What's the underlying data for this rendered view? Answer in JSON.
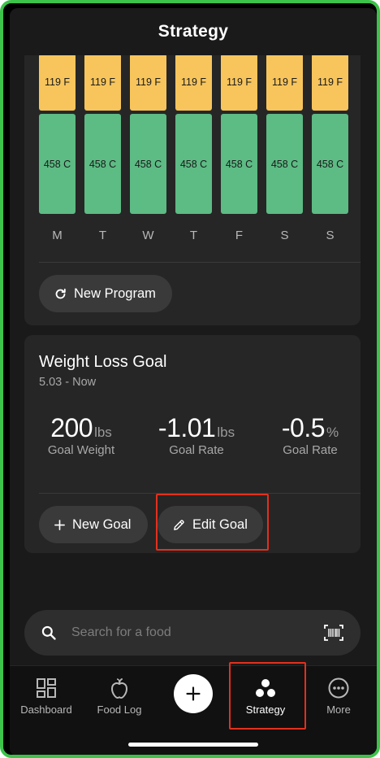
{
  "header": {
    "title": "Strategy"
  },
  "program": {
    "days": [
      {
        "day": "M",
        "fat": "119 F",
        "carb": "458 C"
      },
      {
        "day": "T",
        "fat": "119 F",
        "carb": "458 C"
      },
      {
        "day": "W",
        "fat": "119 F",
        "carb": "458 C"
      },
      {
        "day": "T",
        "fat": "119 F",
        "carb": "458 C"
      },
      {
        "day": "F",
        "fat": "119 F",
        "carb": "458 C"
      },
      {
        "day": "S",
        "fat": "119 F",
        "carb": "458 C"
      },
      {
        "day": "S",
        "fat": "119 F",
        "carb": "458 C"
      }
    ],
    "new_program_label": "New Program"
  },
  "goal": {
    "title": "Weight Loss Goal",
    "subtitle": "5.03 - Now",
    "stats": [
      {
        "value": "200",
        "unit": "lbs",
        "label": "Goal Weight"
      },
      {
        "value": "-1.01",
        "unit": "lbs",
        "label": "Goal Rate"
      },
      {
        "value": "-0.5",
        "unit": "%",
        "label": "Goal Rate"
      }
    ],
    "new_goal_label": "New Goal",
    "edit_goal_label": "Edit Goal"
  },
  "search": {
    "placeholder": "Search for a food"
  },
  "tabs": [
    {
      "label": "Dashboard",
      "icon": "dashboard-icon"
    },
    {
      "label": "Food Log",
      "icon": "apple-icon"
    },
    {
      "label": "",
      "icon": "plus-icon"
    },
    {
      "label": "Strategy",
      "icon": "strategy-dots-icon"
    },
    {
      "label": "More",
      "icon": "more-icon"
    }
  ],
  "colors": {
    "fat": "#f7c55c",
    "carb": "#5dbb84",
    "highlight": "#e2301e",
    "frame": "#3cc34a"
  }
}
